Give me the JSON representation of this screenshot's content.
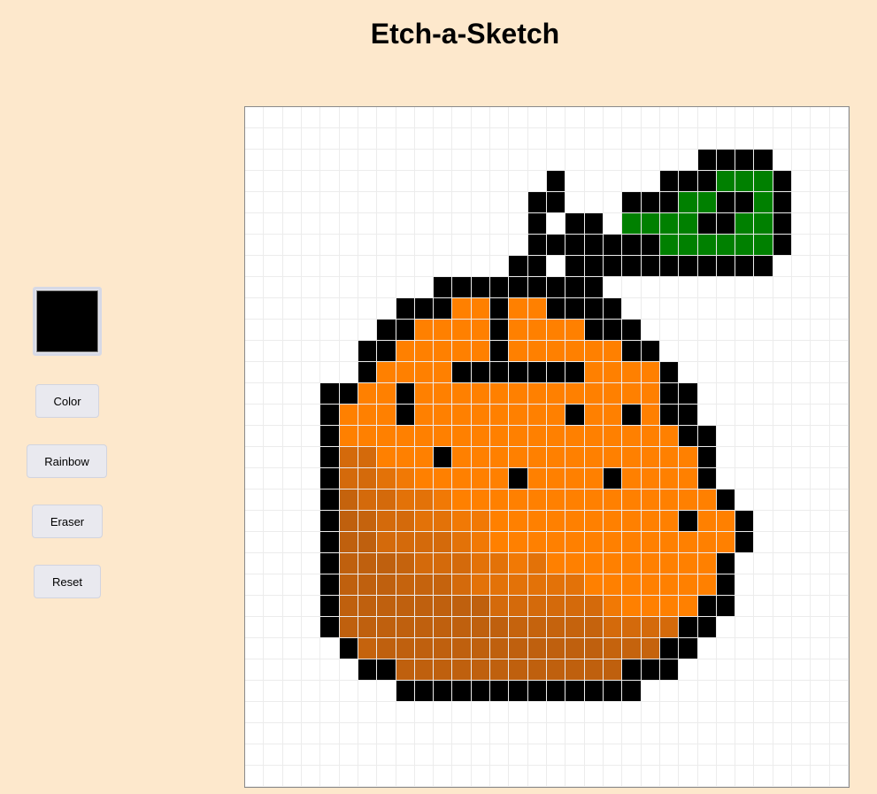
{
  "app": {
    "title": "Etch-a-Sketch"
  },
  "picker": {
    "current_color": "#000000"
  },
  "buttons": {
    "color": "Color",
    "rainbow": "Rainbow",
    "eraser": "Eraser",
    "reset": "Reset"
  },
  "grid": {
    "size": 32,
    "background": "#ffffff",
    "palette": {
      ".": "#ffffff",
      "K": "#000000",
      "G": "#008000",
      "O": "#ff8000",
      "P": "#f17905",
      "Q": "#e37208",
      "R": "#d46a0b",
      "S": "#c5630d",
      "T": "#bf600e"
    },
    "rows": [
      "................................",
      "................................",
      "........................KKKK....",
      "................K.....KKKGGGK...",
      "...............KK...KKKGGKKGK...",
      "...............K.KK.GGGGKKGGK...",
      "...............KKKKKKKGGGGGGK...",
      "..............KK.KKKKKKKKKKK....",
      "..........KKKKKKKKK.............",
      "........KKKOOKOOKKKK............",
      ".......KKOOOOKOOOOKKK...........",
      "......KKOOOOOKOOOOOOKK..........",
      "......KOOOOKKKKKKKOOOOK.........",
      "....KKOOKOOOOOOOOOOOOOKK........",
      "....KOOOKOOOOOOOOKOOKOKK........",
      "....KOOOOOOOOOOOOOOOOOOKK.......",
      "....KRROOOKOOOOOOOOOOOOOK.......",
      "....KRRQPOOOOOKOOOOKOOOOK.......",
      "....KSRRQQPOOOOOOOOOOOOOOK......",
      "....KTSRRQQPPOOOOOOOOOOKOOK.....",
      "....KTTRRRRQPOOOOOOOOOOOOOK.....",
      "....KTTTSRRRQQPQOOOOOOOOOK......",
      "....KTTTSSSRQQQQQQOOOOOOOK......",
      "....KTTTTTTTTRRRRRRPOOOOKK......",
      "....KTTTTTTTTTSSSSSRRRRKK.......",
      ".....KSTTTTTTTTTTTTSSSKK........",
      "......KKTTTTTTTTTTTTKKK.........",
      "........KKKKKKKKKKKKK...........",
      "................................",
      "................................",
      "................................",
      "................................"
    ]
  }
}
